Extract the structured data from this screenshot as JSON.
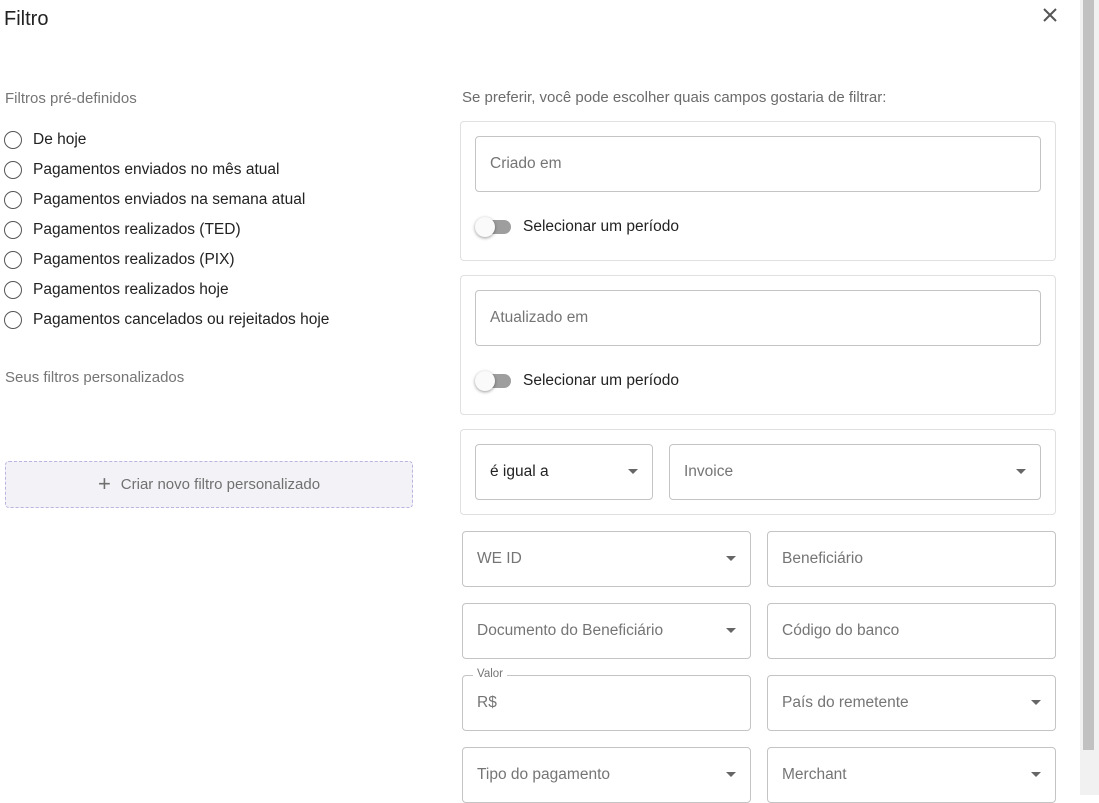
{
  "dialog": {
    "title": "Filtro",
    "close_icon": "close-icon"
  },
  "predefined": {
    "label": "Filtros pré-definidos",
    "options": [
      {
        "label": "De hoje"
      },
      {
        "label": "Pagamentos enviados no mês atual"
      },
      {
        "label": "Pagamentos enviados na semana atual"
      },
      {
        "label": "Pagamentos realizados (TED)"
      },
      {
        "label": "Pagamentos realizados (PIX)"
      },
      {
        "label": "Pagamentos realizados hoje"
      },
      {
        "label": "Pagamentos cancelados ou rejeitados hoje"
      }
    ]
  },
  "custom": {
    "label": "Seus filtros personalizados",
    "create_label": "Criar novo filtro personalizado",
    "create_icon": "plus-icon"
  },
  "fields_section": {
    "hint": "Se preferir, você pode escolher quais campos gostaria de filtrar:",
    "created": {
      "placeholder": "Criado em",
      "period_toggle_label": "Selecionar um período"
    },
    "updated": {
      "placeholder": "Atualizado em",
      "period_toggle_label": "Selecionar um período"
    },
    "condition": {
      "operator": "é igual a",
      "field": "Invoice"
    },
    "we_id": "WE ID",
    "beneficiario": "Beneficiário",
    "documento_beneficiario": "Documento do Beneficiário",
    "codigo_banco": "Código do banco",
    "valor": {
      "label": "Valor",
      "prefix": "R$"
    },
    "pais_remetente": "País do remetente",
    "tipo_pagamento": "Tipo do pagamento",
    "merchant": "Merchant"
  }
}
